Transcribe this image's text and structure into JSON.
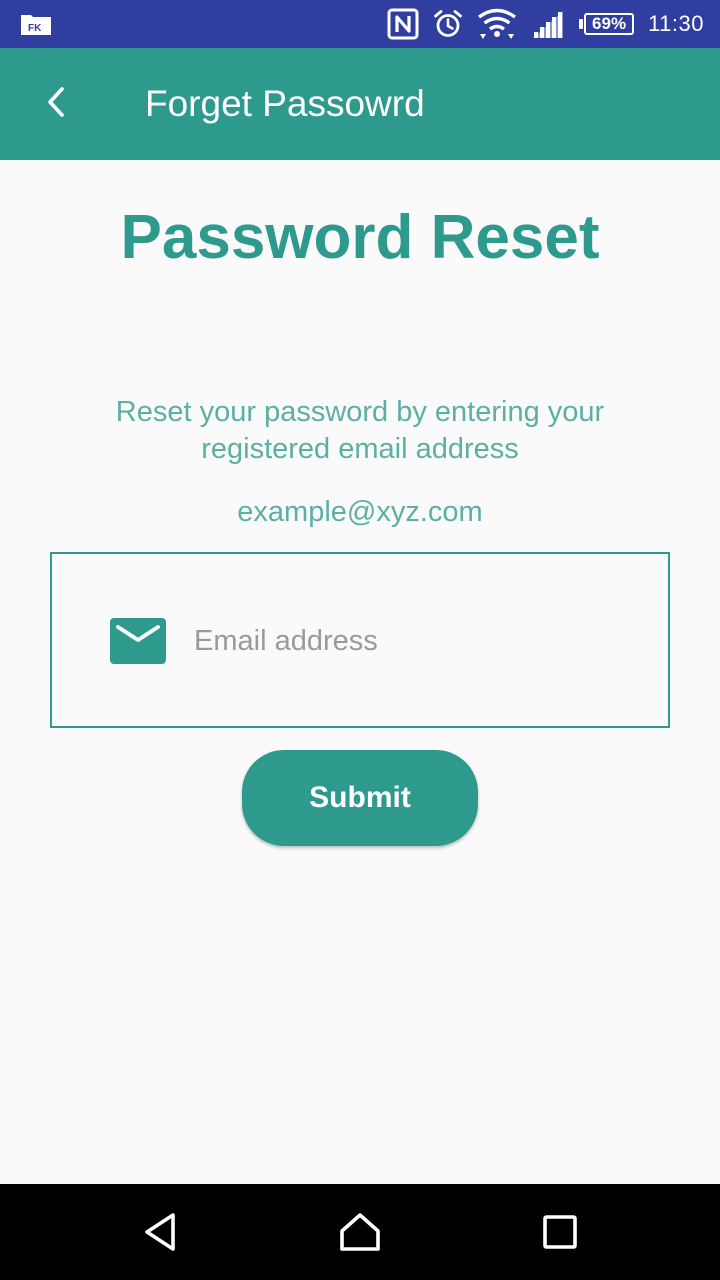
{
  "status_bar": {
    "left_icon": "app-notification-icon",
    "icons": [
      "nfc-icon",
      "alarm-icon",
      "wifi-icon",
      "signal-icon"
    ],
    "battery": "69%",
    "time": "11:30"
  },
  "app_bar": {
    "back_icon": "chevron-left-icon",
    "title": "Forget Passowrd"
  },
  "main": {
    "heading": "Password Reset",
    "instructions": "Reset your password by entering your registered email address",
    "example": "example@xyz.com",
    "email": {
      "icon": "mail-icon",
      "placeholder": "Email address",
      "value": ""
    },
    "submit_label": "Submit"
  },
  "nav_bar": {
    "icons": [
      "back-triangle-icon",
      "home-icon",
      "recents-icon"
    ]
  },
  "colors": {
    "status_bar": "#303f9f",
    "accent": "#2e998d",
    "secondary_text": "#5cafa5",
    "background": "#fafafa"
  }
}
